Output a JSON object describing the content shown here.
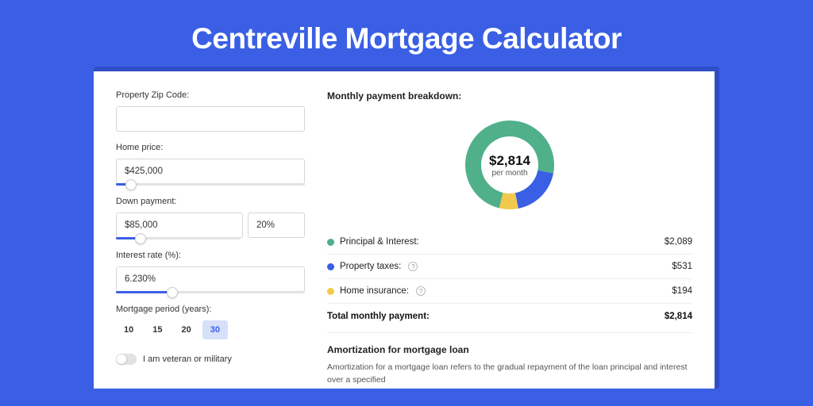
{
  "title": "Centreville Mortgage Calculator",
  "form": {
    "zip_label": "Property Zip Code:",
    "zip_value": "",
    "price_label": "Home price:",
    "price_value": "$425,000",
    "price_slider_pct": 8,
    "down_label": "Down payment:",
    "down_value": "$85,000",
    "down_pct_value": "20%",
    "down_slider_pct": 20,
    "rate_label": "Interest rate (%):",
    "rate_value": "6.230%",
    "rate_slider_pct": 30,
    "period_label": "Mortgage period (years):",
    "periods": [
      "10",
      "15",
      "20",
      "30"
    ],
    "period_active_index": 3,
    "veteran_label": "I am veteran or military"
  },
  "breakdown": {
    "heading": "Monthly payment breakdown:",
    "center_amount": "$2,814",
    "center_sub": "per month",
    "items": [
      {
        "label": "Principal & Interest:",
        "value": "$2,089",
        "color": "#4fb08a",
        "help": false,
        "fraction": 0.742
      },
      {
        "label": "Property taxes:",
        "value": "$531",
        "color": "#3a5fe5",
        "help": true,
        "fraction": 0.189
      },
      {
        "label": "Home insurance:",
        "value": "$194",
        "color": "#f2c94c",
        "help": true,
        "fraction": 0.069
      }
    ],
    "total_label": "Total monthly payment:",
    "total_value": "$2,814"
  },
  "amortization": {
    "heading": "Amortization for mortgage loan",
    "body": "Amortization for a mortgage loan refers to the gradual repayment of the loan principal and interest over a specified"
  },
  "chart_data": {
    "type": "pie",
    "title": "Monthly payment breakdown",
    "series": [
      {
        "name": "Principal & Interest",
        "value": 2089,
        "color": "#4fb08a"
      },
      {
        "name": "Property taxes",
        "value": 531,
        "color": "#3a5fe5"
      },
      {
        "name": "Home insurance",
        "value": 194,
        "color": "#f2c94c"
      }
    ],
    "total": 2814,
    "center_label": "$2,814 per month"
  }
}
